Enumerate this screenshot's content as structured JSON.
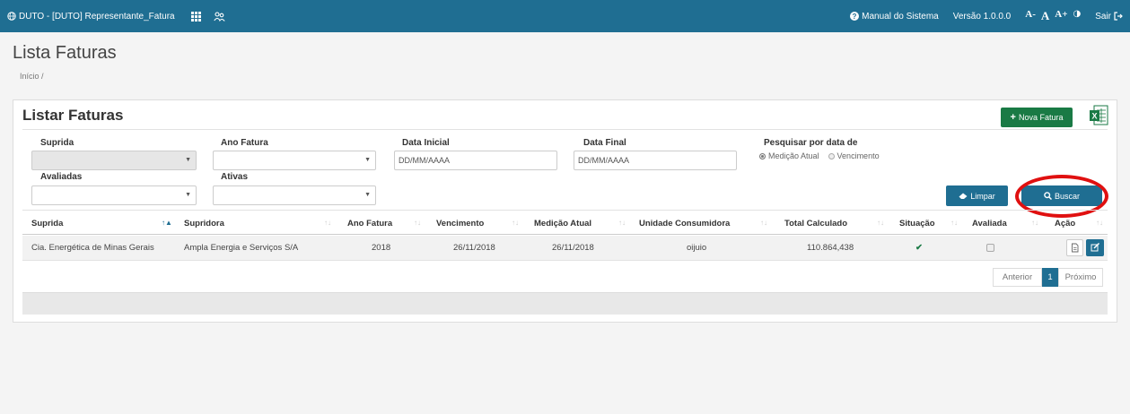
{
  "topbar": {
    "app_title": "DUTO - [DUTO] Representante_Fatura",
    "manual_label": "Manual do Sistema",
    "version": "Versão 1.0.0.0",
    "font_small": "A-",
    "font_normal": "A",
    "font_large": "A+",
    "contrast": "◑",
    "exit_label": "Sair"
  },
  "page": {
    "title": "Lista Faturas",
    "breadcrumb": "Início /"
  },
  "panel": {
    "title": "Listar Faturas",
    "new_button": "Nova Fatura"
  },
  "filters": {
    "suprida_label": "Suprida",
    "ano_label": "Ano Fatura",
    "data_inicial_label": "Data Inicial",
    "data_inicial_placeholder": "DD/MM/AAAA",
    "data_final_label": "Data Final",
    "data_final_placeholder": "DD/MM/AAAA",
    "pesquisar_label": "Pesquisar por data de",
    "radio_options": [
      "Medição Atual",
      "Vencimento"
    ],
    "radio_selected": "Medição Atual",
    "avaliadas_label": "Avaliadas",
    "ativas_label": "Ativas",
    "limpar_button": "Limpar",
    "buscar_button": "Buscar"
  },
  "table": {
    "headers": [
      "Suprida",
      "Supridora",
      "Ano Fatura",
      "Vencimento",
      "Medição Atual",
      "Unidade Consumidora",
      "Total Calculado",
      "Situação",
      "Avaliada",
      "Ação"
    ],
    "rows": [
      {
        "suprida": "Cia. Energética de Minas Gerais",
        "supridora": "Ampla Energia e Serviços S/A",
        "ano": "2018",
        "vencimento": "26/11/2018",
        "medicao": "26/11/2018",
        "unidade": "oijuio",
        "total": "110.864,438",
        "situacao": "✔"
      }
    ]
  },
  "pagination": {
    "prev": "Anterior",
    "current": "1",
    "next": "Próximo"
  },
  "colors": {
    "primary": "#1f6e92",
    "success": "#1a7a45",
    "highlight": "#e01010"
  }
}
